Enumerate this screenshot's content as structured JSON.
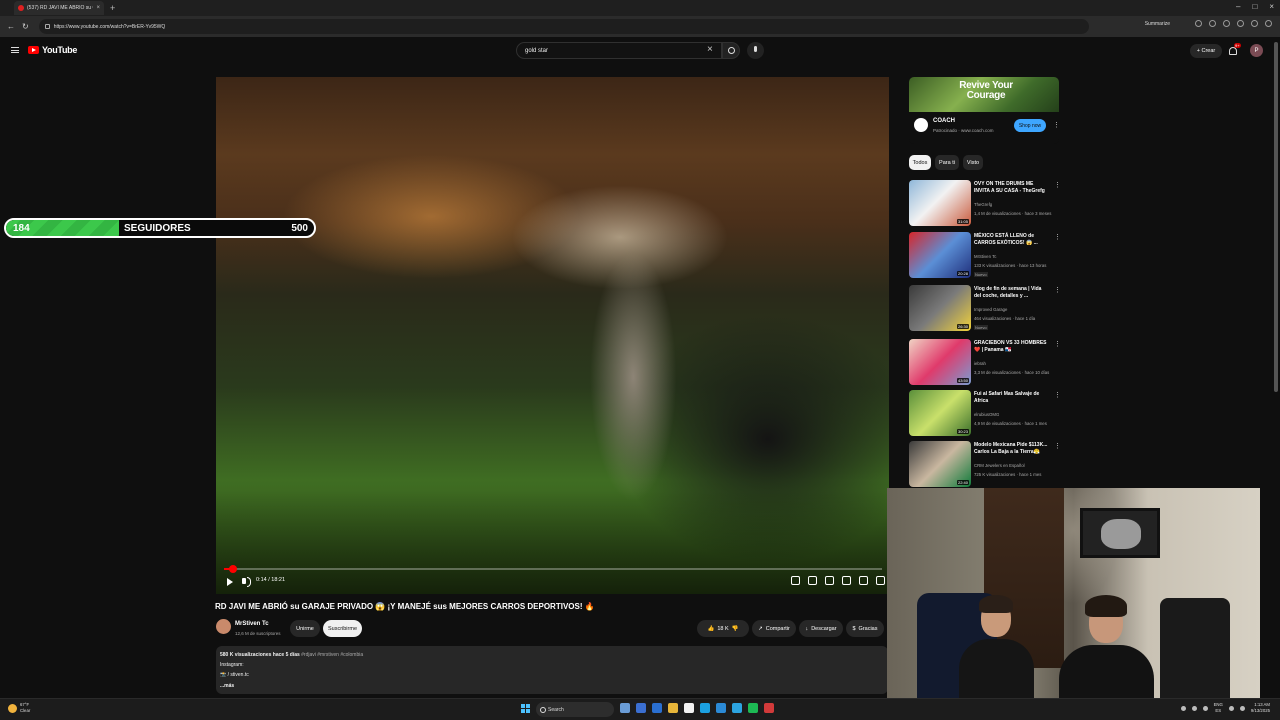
{
  "browser": {
    "tab_title": "(537) RD JAVI ME ABRIÓ su GAR...",
    "url": "https://www.youtube.com/watch?v=BrER-Yv95WQ",
    "summarize_label": "Summarize"
  },
  "header": {
    "logo_text": "YouTube",
    "search_query": "gold star",
    "create_label": "+ Crear",
    "notifications_count": "9+",
    "avatar_letter": "P"
  },
  "player": {
    "time": "0:14 / 18:21",
    "progress_fraction": 0.013
  },
  "followers_overlay": {
    "current": "184",
    "label": "SEGUIDORES",
    "goal": "500",
    "fill_fraction": 0.368
  },
  "video": {
    "title": "RD JAVI ME ABRIÓ su GARAJE PRIVADO 😱 ¡Y MANEJÉ sus MEJORES CARROS DEPORTIVOS! 🔥",
    "channel": "MrStiven Tc",
    "subscribers": "12,6 M de suscriptores",
    "join_label": "Unirme",
    "subscribe_label": "Suscribirme",
    "likes": "18 K",
    "share_label": "Compartir",
    "download_label": "Descargar",
    "thanks_label": "Gracias",
    "description": {
      "stats": "580 K visualizaciones  hace 5 días",
      "tags": "#rdjavi #mrstiven #colombia",
      "line2": "Instagram:",
      "line3": "📸 / stiven.tc",
      "more": "...más"
    }
  },
  "ad": {
    "headline": "Revive Your Courage",
    "brand": "COACH",
    "meta": "Patrocinado · www.coach.com",
    "cta": "Shop now"
  },
  "chips": [
    "Todos",
    "Para ti",
    "Visto"
  ],
  "recommendations": [
    {
      "title": "OVY ON THE DRUMS ME INVITA A SU CASA - TheGrefg",
      "channel": "TheGrefg",
      "stats": "1,4 M de visualizaciones · hace 3 meses",
      "duration": "31:05",
      "badge": ""
    },
    {
      "title": "MÉXICO ESTÁ LLENO de CARROS EXÓTICOS! 😱 ...",
      "channel": "MrStiven Tc",
      "stats": "133 K visualizaciones · hace 13 horas",
      "duration": "20:28",
      "badge": "Nuevo"
    },
    {
      "title": "Vlog de fin de semana | Vida del coche, detalles y ...",
      "channel": "Improved Garage",
      "stats": "464 visualizaciones · hace 1 día",
      "duration": "26:30",
      "badge": "Nuevo"
    },
    {
      "title": "GRACIEBON VS 33 HOMBRES ❤️ | Panama 🇵🇦",
      "channel": "iebrah",
      "stats": "3,3 M de visualizaciones · hace 10 días",
      "duration": "43:50",
      "badge": ""
    },
    {
      "title": "Fui al Safari Mas Salvaje de Africa",
      "channel": "elrubiusOMG",
      "stats": "4,9 M de visualizaciones · hace 1 mes",
      "duration": "30:23",
      "badge": ""
    },
    {
      "title": "Modelo Mexicana Pide $113K... Carlos La Baja a la Tierra😤",
      "channel": "CRM Jewelers en Español",
      "stats": "725 K visualizaciones · hace 1 mes",
      "duration": "22:40",
      "badge": ""
    }
  ],
  "taskbar": {
    "temp": "67°F",
    "weather": "Clear",
    "search_label": "Search",
    "lang_line1": "ENG",
    "lang_line2": "ES",
    "time": "1:13 AM",
    "date": "9/13/2025"
  },
  "colors": {
    "accent": "#ff0000",
    "follower_bar": "#3cc84b",
    "shop_button": "#3ea6ff"
  }
}
